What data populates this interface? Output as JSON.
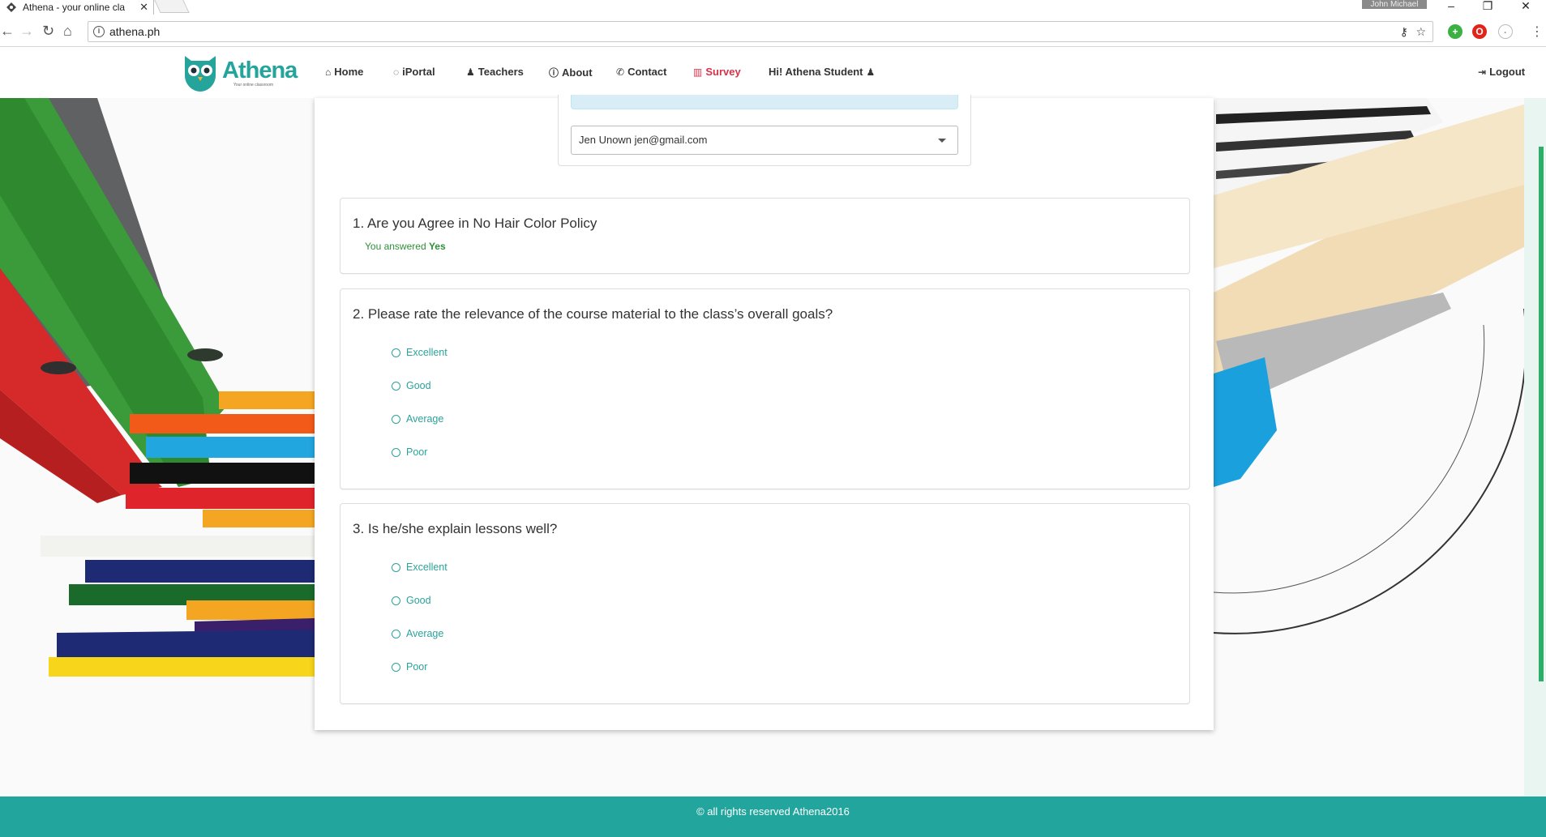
{
  "browser": {
    "tab_title": "Athena - your online cla",
    "tab_close": "✕",
    "user_name": "John Michael",
    "url": "athena.ph",
    "window_minimize": "–",
    "window_restore": "❐",
    "window_close": "✕"
  },
  "site": {
    "logo_text": "Athena",
    "logo_tagline": "Your online classroom",
    "nav": {
      "home": "Home",
      "iportal": "iPortal",
      "teachers": "Teachers",
      "about": "About",
      "contact": "Contact",
      "survey": "Survey",
      "student": "Hi! Athena Student",
      "logout": "Logout"
    },
    "colors": {
      "brand": "#22a59c",
      "active": "#d6334a",
      "answered": "#2f8f3a"
    }
  },
  "survey": {
    "teacher_select": "Jen Unown jen@gmail.com",
    "questions": [
      {
        "title": "1. Are you Agree in No Hair Color Policy",
        "answered_prefix": "You answered",
        "answered_value": "Yes"
      },
      {
        "title": "2. Please rate the relevance of the course material to the class’s overall goals?",
        "options": [
          "Excellent",
          "Good",
          "Average",
          "Poor"
        ]
      },
      {
        "title": "3. Is he/she explain lessons well?",
        "options": [
          "Excellent",
          "Good",
          "Average",
          "Poor"
        ]
      }
    ]
  },
  "footer": {
    "copyright_icon": "©",
    "text": "all rights reserved Athena2016"
  }
}
